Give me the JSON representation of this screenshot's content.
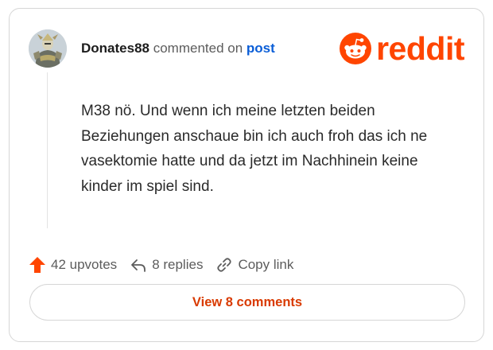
{
  "comment": {
    "author": "Donates88",
    "action_text": "commented on",
    "target_link": "post",
    "avatar_icon": "armored-character-avatar",
    "body": "M38 nö. Und wenn ich meine letzten beiden Beziehungen anschaue bin ich auch froh das ich ne vasektomie hatte und da jetzt im Nachhinein keine kinder im spiel sind."
  },
  "brand": {
    "logo_icon": "reddit-snoo-icon",
    "wordmark": "reddit",
    "color": "#ff4500"
  },
  "actions": {
    "upvotes": "42 upvotes",
    "replies": "8 replies",
    "copy_link": "Copy link",
    "upvote_color": "#ff4500"
  },
  "footer": {
    "view_comments": "View 8 comments",
    "button_text_color": "#d93a00"
  }
}
